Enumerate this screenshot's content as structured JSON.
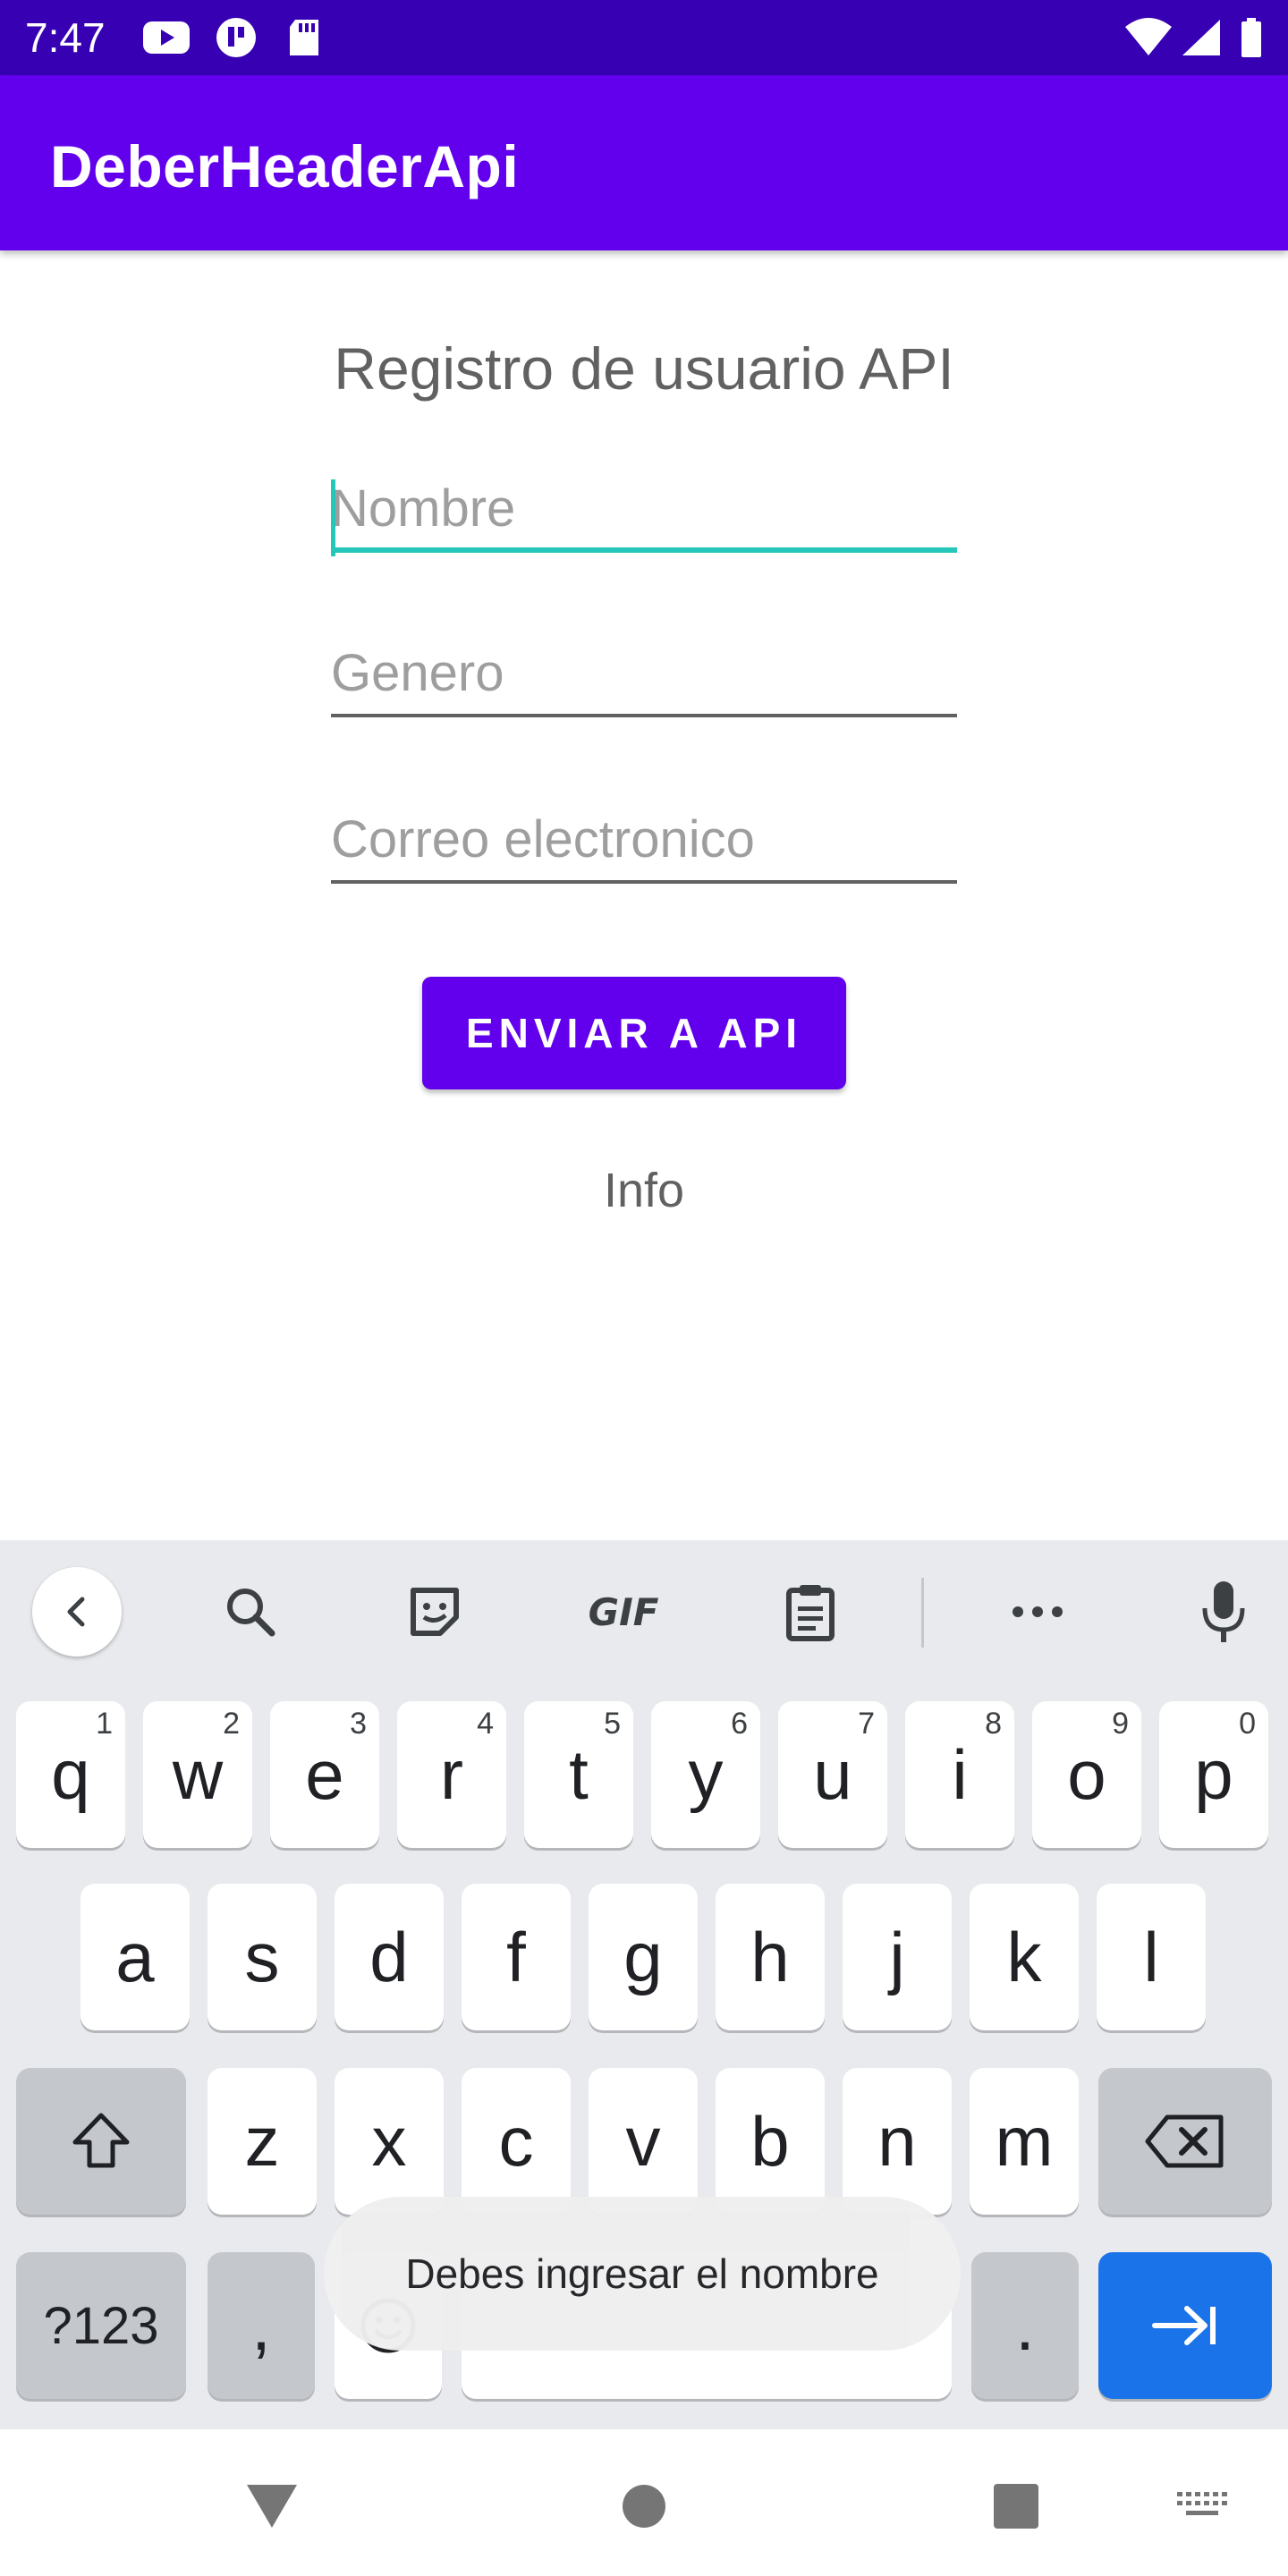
{
  "status_bar": {
    "time": "7:47",
    "icons": [
      "youtube-icon",
      "app-icon",
      "sd-card-icon",
      "wifi-icon",
      "signal-icon",
      "battery-icon"
    ]
  },
  "app_bar": {
    "title": "DeberHeaderApi",
    "color": "#6200ee"
  },
  "form": {
    "title": "Registro de usuario API",
    "fields": {
      "nombre": {
        "placeholder": "Nombre",
        "value": ""
      },
      "genero": {
        "placeholder": "Genero",
        "value": ""
      },
      "correo": {
        "placeholder": "Correo electronico",
        "value": ""
      }
    },
    "submit_label": "ENVIAR A API",
    "info": "Info"
  },
  "keyboard": {
    "toolbar": [
      "back-icon",
      "search-icon",
      "sticker-icon",
      "gif-icon",
      "clipboard-icon",
      "more-icon",
      "mic-icon"
    ],
    "gif_label": "GIF",
    "row1": [
      {
        "k": "q",
        "h": "1"
      },
      {
        "k": "w",
        "h": "2"
      },
      {
        "k": "e",
        "h": "3"
      },
      {
        "k": "r",
        "h": "4"
      },
      {
        "k": "t",
        "h": "5"
      },
      {
        "k": "y",
        "h": "6"
      },
      {
        "k": "u",
        "h": "7"
      },
      {
        "k": "i",
        "h": "8"
      },
      {
        "k": "o",
        "h": "9"
      },
      {
        "k": "p",
        "h": "0"
      }
    ],
    "row2": [
      "a",
      "s",
      "d",
      "f",
      "g",
      "h",
      "j",
      "k",
      "l"
    ],
    "row3": [
      "z",
      "x",
      "c",
      "v",
      "b",
      "n",
      "m"
    ],
    "symbols_label": "?123",
    "comma_label": ",",
    "period_label": "."
  },
  "toast": "Debes ingresar el nombre",
  "colors": {
    "accent": "#6200ee",
    "status": "#3700b3",
    "focus": "#26c6b8",
    "keyboard_action": "#1a73e8"
  }
}
